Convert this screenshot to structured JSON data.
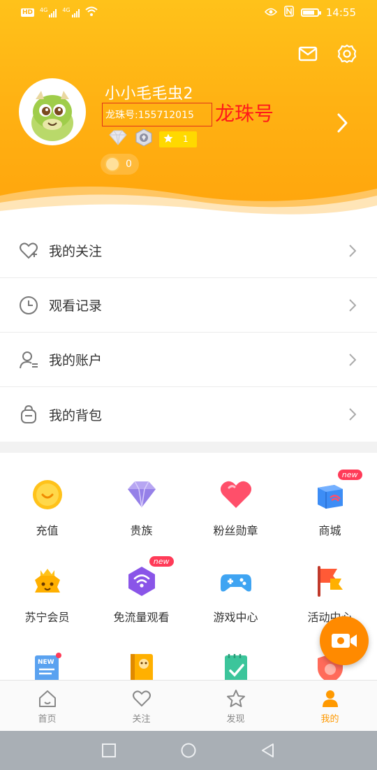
{
  "status_bar": {
    "left_icons": [
      "hd-icon",
      "signal-4g-icon",
      "signal-4g-icon",
      "wifi-icon"
    ],
    "left_texts": [
      "HD",
      "4G",
      "4G"
    ],
    "time": "14:55",
    "right_icons": [
      "eye-icon",
      "nfc-icon",
      "battery-icon"
    ]
  },
  "profile": {
    "username": "小小毛毛虫2",
    "id_label": "龙珠号:155712015",
    "annotation": "龙珠号",
    "level_badge": "1",
    "coin_count": "0"
  },
  "menu": {
    "items": [
      {
        "label": "我的关注",
        "icon": "heart-plus-icon"
      },
      {
        "label": "观看记录",
        "icon": "clock-icon"
      },
      {
        "label": "我的账户",
        "icon": "user-account-icon"
      },
      {
        "label": "我的背包",
        "icon": "backpack-icon"
      }
    ]
  },
  "grid": {
    "items": [
      {
        "label": "充值",
        "icon": "recharge-icon"
      },
      {
        "label": "贵族",
        "icon": "diamond-icon"
      },
      {
        "label": "粉丝勋章",
        "icon": "fan-medal-icon"
      },
      {
        "label": "商城",
        "icon": "shop-icon",
        "tag": "new"
      },
      {
        "label": "苏宁会员",
        "icon": "suning-member-icon"
      },
      {
        "label": "免流量观看",
        "icon": "free-data-icon",
        "tag": "new"
      },
      {
        "label": "游戏中心",
        "icon": "gamepad-icon"
      },
      {
        "label": "活动中心",
        "icon": "activity-flag-icon"
      },
      {
        "label": "",
        "icon": "news-icon"
      },
      {
        "label": "",
        "icon": "book-icon"
      },
      {
        "label": "",
        "icon": "checklist-icon"
      },
      {
        "label": "",
        "icon": "shield-icon"
      }
    ]
  },
  "tabbar": {
    "tabs": [
      {
        "label": "首页",
        "icon": "home-icon"
      },
      {
        "label": "关注",
        "icon": "heart-icon"
      },
      {
        "label": "发现",
        "icon": "star-icon"
      },
      {
        "label": "我的",
        "icon": "person-icon",
        "active": true
      }
    ]
  },
  "colors": {
    "header_top": "#ffc21a",
    "header_bottom": "#ffa40c",
    "accent": "#ff9900",
    "annotation_red": "#ff1a1a",
    "new_tag": "#ff3b58"
  }
}
